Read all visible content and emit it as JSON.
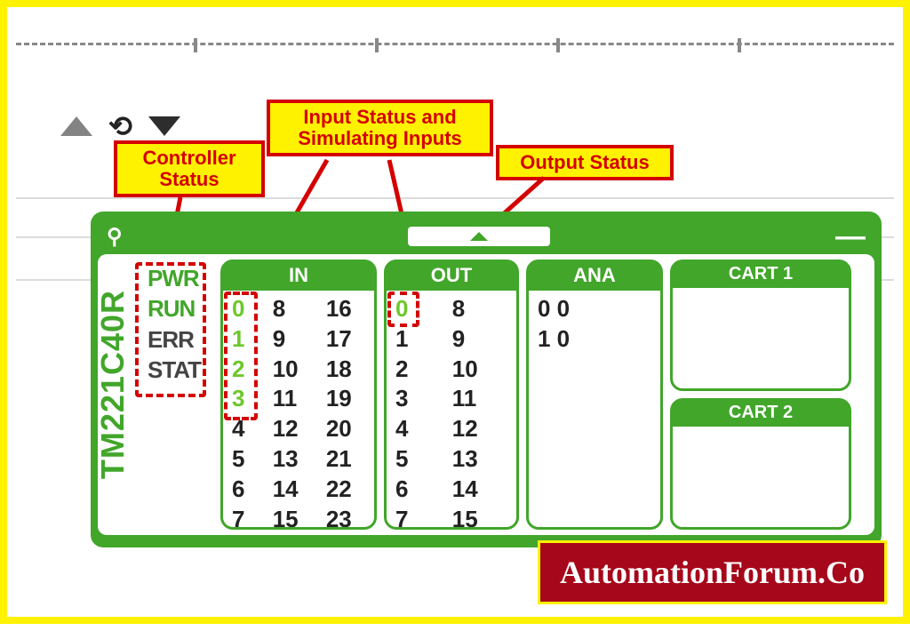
{
  "callouts": {
    "controller": "Controller\nStatus",
    "inputs": "Input Status and\nSimulating Inputs",
    "output": "Output Status"
  },
  "model": "TM221C40R",
  "topbar": {
    "pin": "⚲",
    "minimize": "—"
  },
  "status": [
    {
      "label": "PWR",
      "on": true
    },
    {
      "label": "RUN",
      "on": true
    },
    {
      "label": "ERR",
      "on": false
    },
    {
      "label": "STAT",
      "on": false
    }
  ],
  "columns": {
    "in": {
      "header": "IN",
      "channels": [
        {
          "n": 0,
          "on": true
        },
        {
          "n": 8,
          "on": false
        },
        {
          "n": 16,
          "on": false
        },
        {
          "n": 1,
          "on": true
        },
        {
          "n": 9,
          "on": false
        },
        {
          "n": 17,
          "on": false
        },
        {
          "n": 2,
          "on": true
        },
        {
          "n": 10,
          "on": false
        },
        {
          "n": 18,
          "on": false
        },
        {
          "n": 3,
          "on": true
        },
        {
          "n": 11,
          "on": false
        },
        {
          "n": 19,
          "on": false
        },
        {
          "n": 4,
          "on": false
        },
        {
          "n": 12,
          "on": false
        },
        {
          "n": 20,
          "on": false
        },
        {
          "n": 5,
          "on": false
        },
        {
          "n": 13,
          "on": false
        },
        {
          "n": 21,
          "on": false
        },
        {
          "n": 6,
          "on": false
        },
        {
          "n": 14,
          "on": false
        },
        {
          "n": 22,
          "on": false
        },
        {
          "n": 7,
          "on": false
        },
        {
          "n": 15,
          "on": false
        },
        {
          "n": 23,
          "on": false
        }
      ],
      "cols": 3
    },
    "out": {
      "header": "OUT",
      "channels": [
        {
          "n": 0,
          "on": true
        },
        {
          "n": 8,
          "on": false
        },
        {
          "n": 1,
          "on": false
        },
        {
          "n": 9,
          "on": false
        },
        {
          "n": 2,
          "on": false
        },
        {
          "n": 10,
          "on": false
        },
        {
          "n": 3,
          "on": false
        },
        {
          "n": 11,
          "on": false
        },
        {
          "n": 4,
          "on": false
        },
        {
          "n": 12,
          "on": false
        },
        {
          "n": 5,
          "on": false
        },
        {
          "n": 13,
          "on": false
        },
        {
          "n": 6,
          "on": false
        },
        {
          "n": 14,
          "on": false
        },
        {
          "n": 7,
          "on": false
        },
        {
          "n": 15,
          "on": false
        }
      ],
      "cols": 2
    },
    "ana": {
      "header": "ANA",
      "rows": [
        {
          "ch": 0,
          "val": 0
        },
        {
          "ch": 1,
          "val": 0
        }
      ]
    },
    "cart1": {
      "header": "CART 1"
    },
    "cart2": {
      "header": "CART 2"
    }
  },
  "brand": "AutomationForum.Co"
}
